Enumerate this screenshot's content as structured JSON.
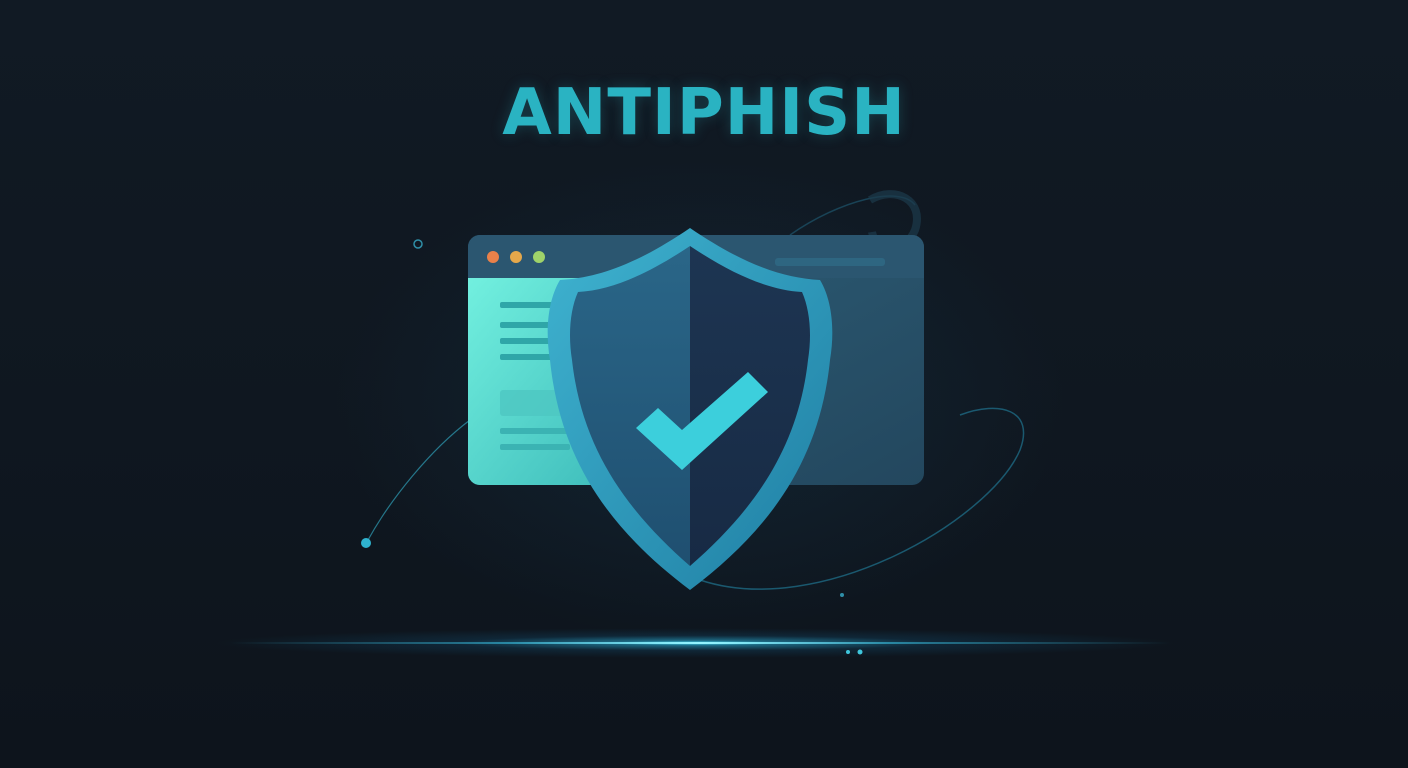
{
  "brand": {
    "title": "ANTIPHISH"
  },
  "illustration": {
    "shield_icon": "shield-check-icon",
    "window_icon": "browser-window-icon",
    "window_dots": [
      "#e9814a",
      "#e5a84b",
      "#9fd36a"
    ]
  },
  "colors": {
    "background": "#0f1620",
    "accent": "#2ab3c2",
    "window_panel": "#5ee0d0",
    "shield_dark": "#1b3a5a",
    "check": "#3ccfdc"
  }
}
